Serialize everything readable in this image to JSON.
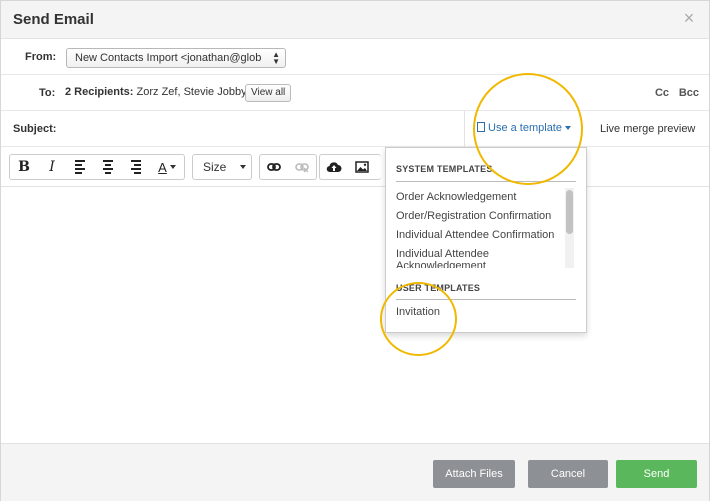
{
  "dialog": {
    "title": "Send Email",
    "close_glyph": "×"
  },
  "from": {
    "label": "From:",
    "value": "New Contacts Import <jonathan@glob",
    "arrows": "▲▼"
  },
  "to": {
    "label": "To:",
    "count": "2 Recipients:",
    "names": " Zorz Zef, Stevie Jobby",
    "view_all": "View all",
    "cc": "Cc",
    "bcc": "Bcc"
  },
  "subject": {
    "label": "Subject:",
    "template_button": "Use a template",
    "live_preview": "Live merge preview"
  },
  "toolbar": {
    "bold": "B",
    "italic": "I",
    "font_color": "A",
    "size_label": "Size"
  },
  "templates": {
    "system_heading": "SYSTEM TEMPLATES",
    "system_items": [
      "Order Acknowledgement",
      "Order/Registration Confirmation",
      "Individual Attendee Confirmation",
      "Individual Attendee Acknowledgement"
    ],
    "user_heading": "USER TEMPLATES",
    "user_items": [
      "Invitation"
    ]
  },
  "footer": {
    "attach": "Attach Files",
    "cancel": "Cancel",
    "send": "Send"
  },
  "colors": {
    "highlight": "#f0b800",
    "send": "#5bb75b",
    "neutral_button": "#8d9094",
    "link": "#2a6fb0"
  }
}
